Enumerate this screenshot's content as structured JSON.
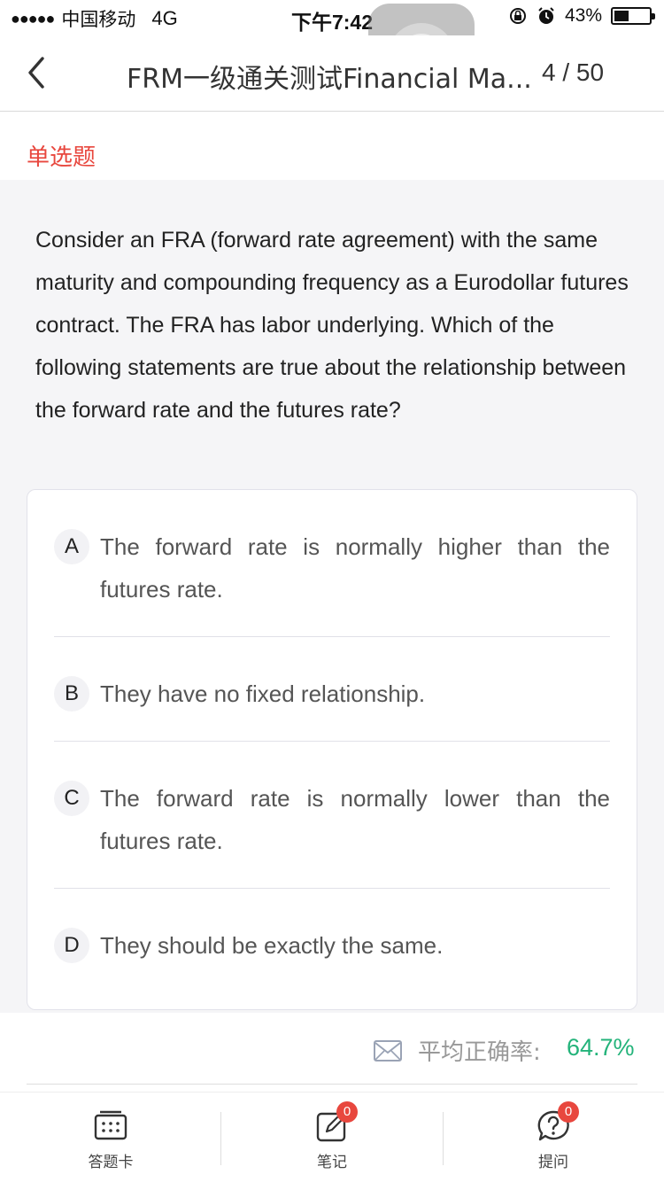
{
  "status_bar": {
    "signal": "●●●●●",
    "carrier": "中国移动",
    "network": "4G",
    "time": "下午7:42",
    "battery_percent": "43%",
    "battery_level": 0.43
  },
  "nav": {
    "title": "FRM一级通关测试Financial Ma...",
    "counter": "4 / 50"
  },
  "question": {
    "type": "单选题",
    "text": "Consider an FRA (forward rate agreement) with the same maturity and compounding frequency as a Eurodollar futures contract. The FRA has labor underlying. Which of the following statements are true about the relationship between the forward rate and the futures rate?",
    "options": [
      {
        "letter": "A",
        "text": "The forward rate is normally higher than the futures rate."
      },
      {
        "letter": "B",
        "text": "They have no fixed relationship."
      },
      {
        "letter": "C",
        "text": "The forward rate is normally lower than the futures rate."
      },
      {
        "letter": "D",
        "text": "They should be exactly the same."
      }
    ]
  },
  "accuracy": {
    "label": "平均正确率:",
    "value": "64.7%"
  },
  "toolbar": {
    "items": [
      {
        "label": "答题卡",
        "icon": "answer-card-icon",
        "badge": ""
      },
      {
        "label": "笔记",
        "icon": "note-edit-icon",
        "badge": "0"
      },
      {
        "label": "提问",
        "icon": "question-chat-icon",
        "badge": "0"
      }
    ]
  },
  "colors": {
    "accent_red": "#e8473e",
    "accent_green": "#23b37a"
  }
}
